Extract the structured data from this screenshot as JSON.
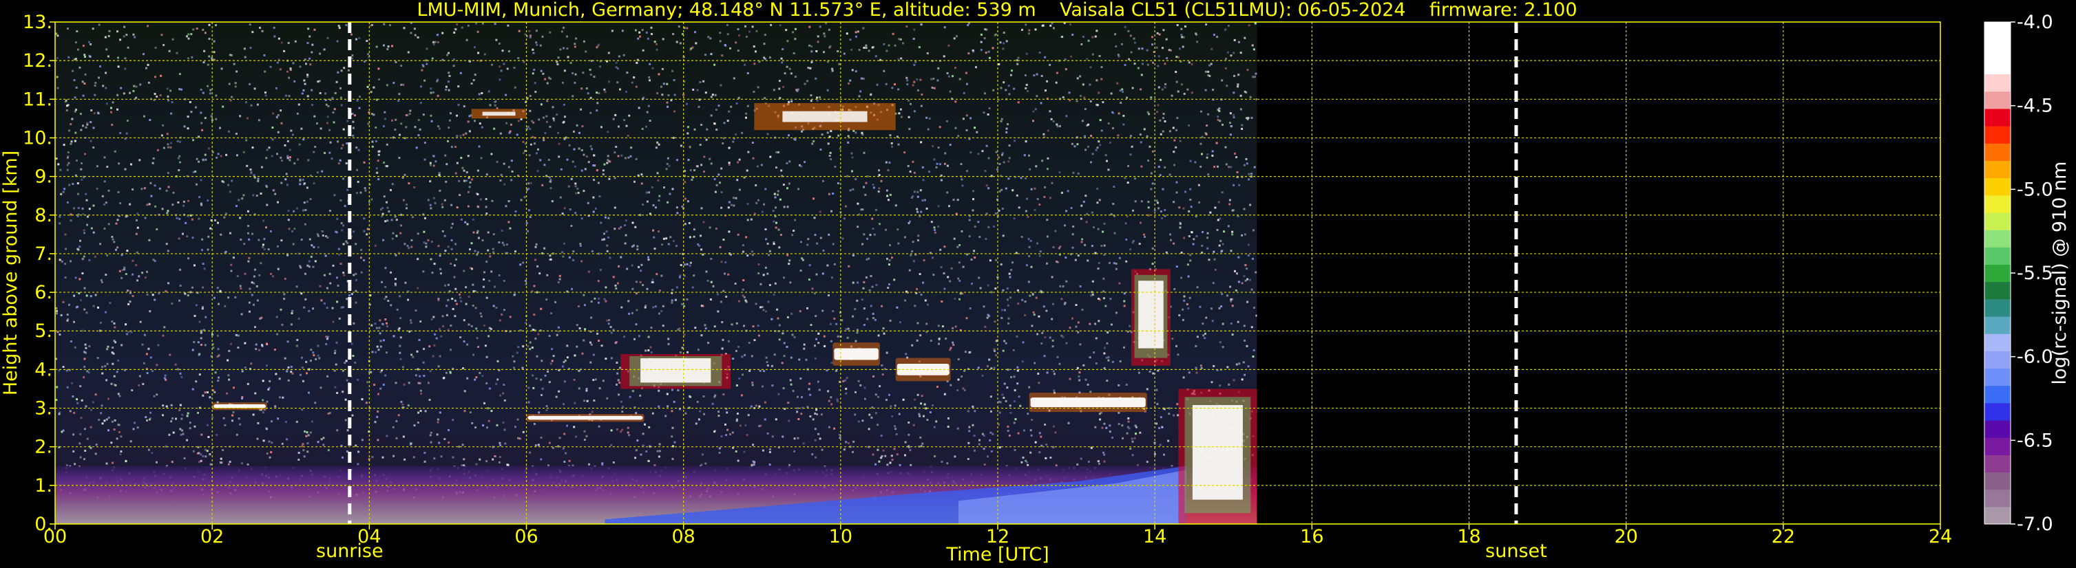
{
  "chart_data": {
    "type": "heatmap",
    "title": "LMU-MIM, Munich, Germany; 48.148° N 11.573° E, altitude: 539 m    Vaisala CL51 (CL51LMU): 06-05-2024    firmware: 2.100",
    "xlabel": "Time [UTC]",
    "ylabel": "Height above ground [km]",
    "xlim": [
      0,
      24
    ],
    "ylim": [
      0,
      13
    ],
    "x_ticks": [
      "00",
      "02",
      "04",
      "06",
      "08",
      "10",
      "12",
      "14",
      "16",
      "18",
      "20",
      "22",
      "24"
    ],
    "y_ticks": [
      "0.",
      "1.",
      "2.",
      "3.",
      "4.",
      "5.",
      "6.",
      "7.",
      "8.",
      "9.",
      "10.",
      "11.",
      "12.",
      "13."
    ],
    "grid": true,
    "colorbar": {
      "label": "log(rc-signal) @ 910 nm",
      "min": -7.0,
      "max": -4.0,
      "ticks": [
        "-4.0",
        "-4.5",
        "-5.0",
        "-5.5",
        "-6.0",
        "-6.5",
        "-7.0"
      ],
      "colors": [
        "#a898a8",
        "#987898",
        "#886088",
        "#8e3c92",
        "#7a1aa0",
        "#5a0aaa",
        "#3030e8",
        "#3a6cf5",
        "#6f8ff8",
        "#8fa2f6",
        "#a9b8f8",
        "#5aa8c0",
        "#2c8c84",
        "#1d7a3c",
        "#2fa83a",
        "#58c86a",
        "#8de27c",
        "#c8f050",
        "#f0f030",
        "#ffd000",
        "#ffa800",
        "#ff7000",
        "#ff2a00",
        "#e8001a",
        "#f0a0a0",
        "#ffd0d0",
        "#ffffff",
        "#ffffff",
        "#ffffff"
      ]
    },
    "markers": [
      {
        "label": "sunrise",
        "x": 3.75
      },
      {
        "label": "sunset",
        "x": 18.6
      }
    ],
    "data_end_hour": 15.3,
    "features": [
      {
        "name": "surface aerosol layer",
        "x": [
          0.0,
          15.3
        ],
        "y": [
          0.0,
          1.5
        ]
      },
      {
        "name": "cloud",
        "x": [
          2.0,
          2.7
        ],
        "y": [
          2.95,
          3.15
        ]
      },
      {
        "name": "cloud",
        "x": [
          6.0,
          7.5
        ],
        "y": [
          2.65,
          2.85
        ]
      },
      {
        "name": "cloud",
        "x": [
          7.2,
          8.6
        ],
        "y": [
          3.5,
          4.4
        ]
      },
      {
        "name": "cloud",
        "x": [
          9.9,
          10.5
        ],
        "y": [
          4.1,
          4.7
        ]
      },
      {
        "name": "cloud",
        "x": [
          10.7,
          11.4
        ],
        "y": [
          3.7,
          4.3
        ]
      },
      {
        "name": "cloud",
        "x": [
          12.4,
          13.9
        ],
        "y": [
          2.9,
          3.4
        ]
      },
      {
        "name": "cloud",
        "x": [
          13.7,
          14.2
        ],
        "y": [
          4.1,
          6.6
        ]
      },
      {
        "name": "cloud",
        "x": [
          14.3,
          15.3
        ],
        "y": [
          0.0,
          3.5
        ]
      },
      {
        "name": "cirrus",
        "x": [
          5.3,
          6.0
        ],
        "y": [
          10.5,
          10.75
        ]
      },
      {
        "name": "cirrus",
        "x": [
          8.9,
          10.7
        ],
        "y": [
          10.2,
          10.9
        ]
      }
    ]
  }
}
